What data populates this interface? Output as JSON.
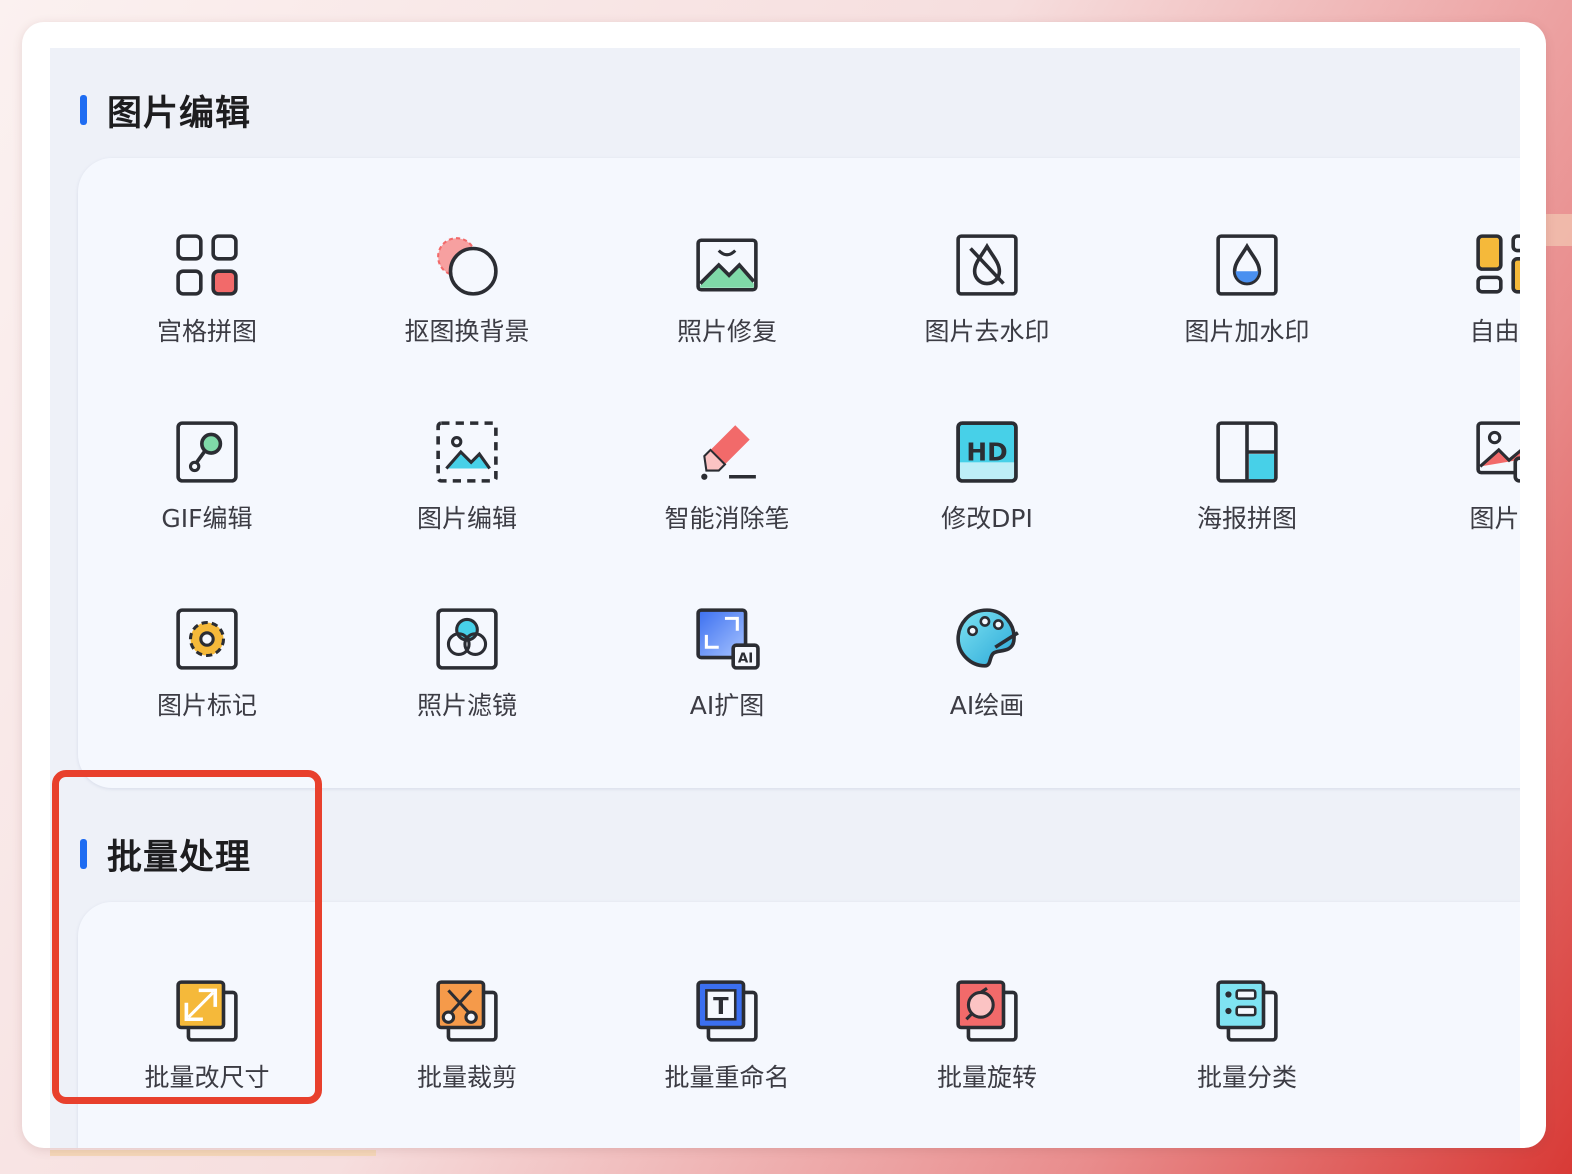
{
  "sections": [
    {
      "title": "图片编辑",
      "tools": [
        {
          "label": "宫格拼图",
          "icon": "grid-icon"
        },
        {
          "label": "抠图换背景",
          "icon": "cutout-background-icon"
        },
        {
          "label": "照片修复",
          "icon": "photo-repair-icon"
        },
        {
          "label": "图片去水印",
          "icon": "remove-watermark-icon"
        },
        {
          "label": "图片加水印",
          "icon": "add-watermark-icon"
        },
        {
          "label": "自由拼",
          "icon": "free-collage-icon"
        },
        {
          "label": "GIF编辑",
          "icon": "gif-edit-icon"
        },
        {
          "label": "图片编辑",
          "icon": "image-edit-icon"
        },
        {
          "label": "智能消除笔",
          "icon": "smart-eraser-icon"
        },
        {
          "label": "修改DPI",
          "icon": "hd-dpi-icon"
        },
        {
          "label": "海报拼图",
          "icon": "poster-collage-icon"
        },
        {
          "label": "图片加",
          "icon": "image-add-icon"
        },
        {
          "label": "图片标记",
          "icon": "image-mark-icon"
        },
        {
          "label": "照片滤镜",
          "icon": "photo-filter-icon"
        },
        {
          "label": "AI扩图",
          "icon": "ai-expand-icon"
        },
        {
          "label": "AI绘画",
          "icon": "ai-paint-palette-icon"
        }
      ]
    },
    {
      "title": "批量处理",
      "tools": [
        {
          "label": "批量改尺寸",
          "icon": "batch-resize-icon"
        },
        {
          "label": "批量裁剪",
          "icon": "batch-crop-icon"
        },
        {
          "label": "批量重命名",
          "icon": "batch-rename-icon"
        },
        {
          "label": "批量旋转",
          "icon": "batch-rotate-icon"
        },
        {
          "label": "批量分类",
          "icon": "batch-classify-icon"
        }
      ]
    }
  ],
  "colors": {
    "accent": "#1e6cf2",
    "highlight_border": "#e8402d",
    "icon_stroke": "#2b2d33",
    "icon_red": "#f26a6a",
    "icon_cyan": "#47d0e8",
    "icon_blue": "#3b6ff0",
    "icon_yellow": "#f5b93a"
  }
}
